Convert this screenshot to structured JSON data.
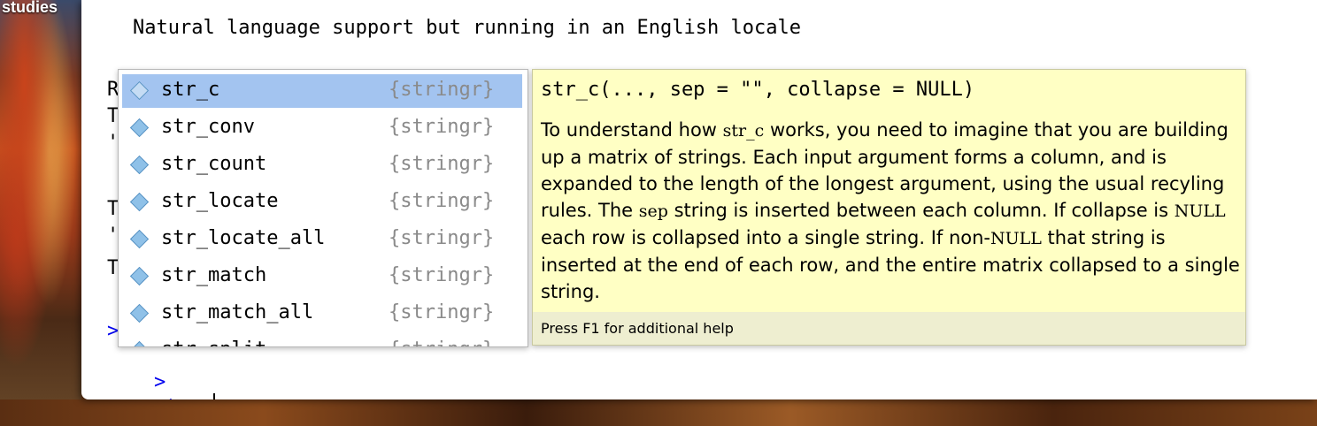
{
  "desktop": {
    "label": "studies"
  },
  "console": {
    "locale_message": "Natural language support but running in an English locale",
    "hidden_fragments": [
      {
        "text": "R",
        "prompt": false
      },
      {
        "text": "T",
        "prompt": false
      },
      {
        "text": "'",
        "prompt": false
      },
      {
        "text": "T",
        "prompt": false
      },
      {
        "text": "'",
        "prompt": false
      },
      {
        "text": "T",
        "prompt": false
      },
      {
        "text": ">",
        "prompt": true
      }
    ],
    "prompt_symbol": ">",
    "input_text": "str_c"
  },
  "completion": {
    "items": [
      {
        "name": "str_c",
        "package": "{stringr}",
        "selected": true
      },
      {
        "name": "str_conv",
        "package": "{stringr}",
        "selected": false
      },
      {
        "name": "str_count",
        "package": "{stringr}",
        "selected": false
      },
      {
        "name": "str_locate",
        "package": "{stringr}",
        "selected": false
      },
      {
        "name": "str_locate_all",
        "package": "{stringr}",
        "selected": false
      },
      {
        "name": "str_match",
        "package": "{stringr}",
        "selected": false
      },
      {
        "name": "str_match_all",
        "package": "{stringr}",
        "selected": false
      },
      {
        "name": "str_split",
        "package": "{stringr}",
        "selected": false
      }
    ]
  },
  "help": {
    "signature": "str_c(..., sep = \"\", collapse = NULL)",
    "description": {
      "t1": "To understand how ",
      "c1": "str_c",
      "t2": " works, you need to imagine that you are building up a matrix of strings. Each input argument forms a column, and is expanded to the length of the longest argument, using the usual recyling rules. The ",
      "c2": "sep",
      "t3": " string is inserted between each column. If collapse is ",
      "c3": "NULL",
      "t4": " each row is collapsed into a single string. If non-",
      "c4": "NULL",
      "t5": " that string is inserted at the end of each row, and the entire matrix collapsed to a single string."
    },
    "footer": "Press F1 for additional help"
  },
  "colors": {
    "selection": "#a3c4f0",
    "tooltip_bg": "#ffffc4",
    "prompt": "#0000ee"
  }
}
